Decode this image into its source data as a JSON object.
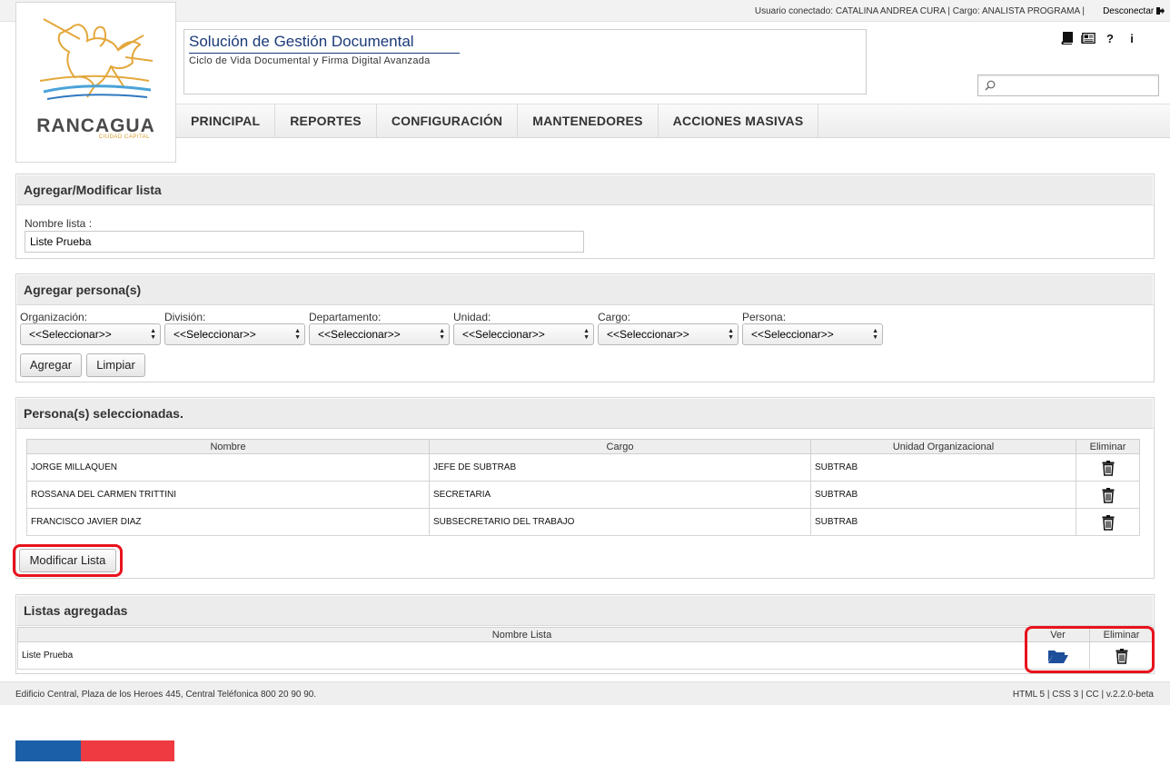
{
  "topbar": {
    "user_info": "Usuario conectado: CATALINA ANDREA CURA | Cargo: ANALISTA PROGRAMA |",
    "logout_label": "Desconectar"
  },
  "logo": {
    "city": "RANCAGUA",
    "subtitle": "CIUDAD CAPITAL"
  },
  "header": {
    "title": "Solución de Gestión Documental",
    "subtitle": "Ciclo de Vida Documental y Firma Digital Avanzada",
    "icons": [
      "book-icon",
      "newspaper-icon",
      "help-icon",
      "info-icon"
    ],
    "search_placeholder": ""
  },
  "nav": {
    "items": [
      "PRINCIPAL",
      "REPORTES",
      "CONFIGURACIÓN",
      "MANTENEDORES",
      "ACCIONES MASIVAS"
    ]
  },
  "panel_list": {
    "title": "Agregar/Modificar lista",
    "name_label": "Nombre lista :",
    "name_value": "Liste Prueba"
  },
  "panel_persons": {
    "title": "Agregar persona(s)",
    "filters": [
      {
        "label": "Organización:",
        "value": "<<Seleccionar>>"
      },
      {
        "label": "División:",
        "value": "<<Seleccionar>>"
      },
      {
        "label": "Departamento:",
        "value": "<<Seleccionar>>"
      },
      {
        "label": "Unidad:",
        "value": "<<Seleccionar>>"
      },
      {
        "label": "Cargo:",
        "value": "<<Seleccionar>>"
      },
      {
        "label": "Persona:",
        "value": "<<Seleccionar>>"
      }
    ],
    "add_label": "Agregar",
    "clear_label": "Limpiar"
  },
  "panel_selected": {
    "title": "Persona(s) seleccionadas.",
    "columns": [
      "Nombre",
      "Cargo",
      "Unidad Organizacional",
      "Eliminar"
    ],
    "rows": [
      {
        "nombre": "JORGE MILLAQUEN",
        "cargo": "JEFE DE SUBTRAB",
        "unidad": "SUBTRAB"
      },
      {
        "nombre": "ROSSANA DEL CARMEN TRITTINI",
        "cargo": "SECRETARIA",
        "unidad": "SUBTRAB"
      },
      {
        "nombre": "FRANCISCO JAVIER DIAZ",
        "cargo": "SUBSECRETARIO DEL TRABAJO",
        "unidad": "SUBTRAB"
      }
    ],
    "modify_label": "Modificar Lista"
  },
  "panel_lists": {
    "title": "Listas agregadas",
    "columns": [
      "Nombre Lista",
      "Ver",
      "Eliminar"
    ],
    "rows": [
      {
        "nombre": "Liste Prueba"
      }
    ]
  },
  "footer": {
    "address": "Edificio Central, Plaza de los Heroes 445, Central Teléfonica 800 20 90 90.",
    "tech": "HTML 5 | CSS 3 | CC | v.2.2.0-beta"
  },
  "colors": {
    "highlight": "#e8121c",
    "title_blue": "#1b3a78",
    "flag_blue": "#1a5fa8",
    "flag_red": "#ef3a41",
    "folder_blue": "#1d4f9a"
  }
}
